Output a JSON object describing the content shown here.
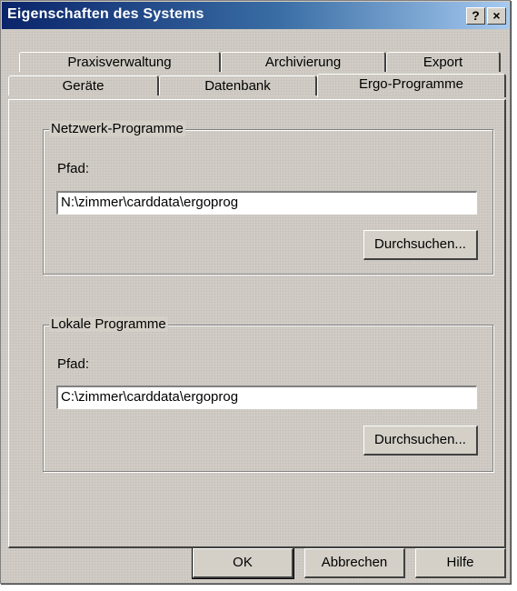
{
  "window": {
    "title": "Eigenschaften des Systems",
    "help_label": "?",
    "close_label": "×"
  },
  "tabs": {
    "row_back": [
      "Praxisverwaltung",
      "Archivierung",
      "Export"
    ],
    "row_front": [
      "Geräte",
      "Datenbank",
      "Ergo-Programme"
    ],
    "selected": "Ergo-Programme"
  },
  "network": {
    "legend": "Netzwerk-Programme",
    "path_label": "Pfad:",
    "path_value": "N:\\zimmer\\carddata\\ergoprog",
    "browse_label": "Durchsuchen..."
  },
  "local": {
    "legend": "Lokale Programme",
    "path_label": "Pfad:",
    "path_value": "C:\\zimmer\\carddata\\ergoprog",
    "browse_label": "Durchsuchen..."
  },
  "footer": {
    "ok_label": "OK",
    "cancel_label": "Abbrechen",
    "help_label": "Hilfe"
  }
}
